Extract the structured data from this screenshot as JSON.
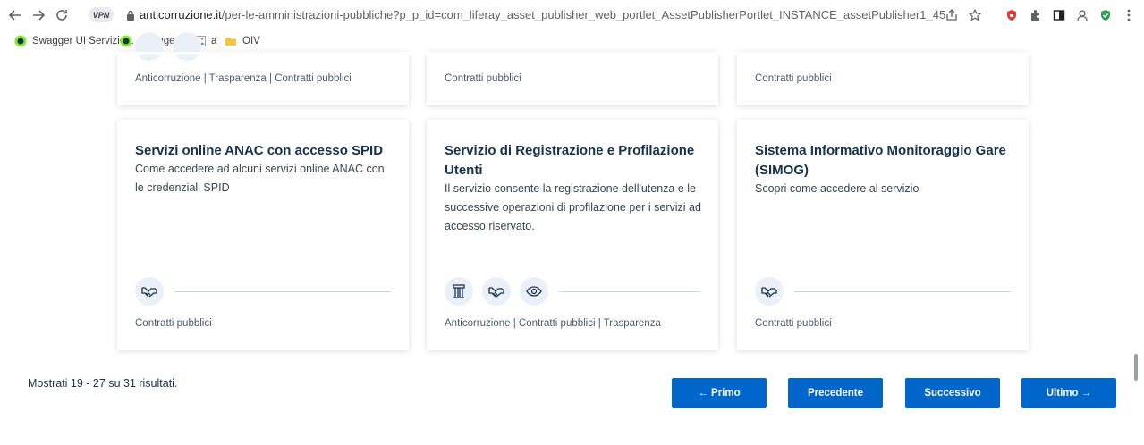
{
  "browser": {
    "vpn_label": "VPN",
    "url_host": "anticorruzione.it",
    "url_path": "/per-le-amministrazioni-pubbliche?p_p_id=com_liferay_asset_publisher_web_portlet_AssetPublisherPortlet_INSTANCE_assetPublisher1_45246&p_p_lifecycle=..."
  },
  "bookmarks": [
    {
      "label": "Swagger UI Servizio..."
    },
    {
      "label": "Swagger UI"
    },
    {
      "label": "a"
    },
    {
      "label": "OIV"
    }
  ],
  "top_row_cards": [
    {
      "categories": "Anticorruzione | Trasparenza | Contratti pubblici"
    },
    {
      "categories": "Contratti pubblici"
    },
    {
      "categories": "Contratti pubblici"
    }
  ],
  "cards": [
    {
      "title": "Servizi online ANAC con accesso SPID",
      "description": "Come accedere ad alcuni servizi online ANAC con le credenziali SPID",
      "icons": [
        "handshake-icon"
      ],
      "categories": "Contratti pubblici"
    },
    {
      "title": "Servizio di Registrazione e Profilazione Utenti",
      "description": "Il servizio consente la registrazione dell'utenza e le successive operazioni di profilazione per i servizi ad accesso riservato.",
      "icons": [
        "column-icon",
        "handshake-icon",
        "eye-icon"
      ],
      "categories": "Anticorruzione | Contratti pubblici | Trasparenza"
    },
    {
      "title": "Sistema Informativo Monitoraggio Gare (SIMOG)",
      "description": "Scopri come accedere al servizio",
      "icons": [
        "handshake-icon"
      ],
      "categories": "Contratti pubblici"
    }
  ],
  "pagination": {
    "results_text": "Mostrati 19 - 27 su 31 risultati.",
    "first": "← Primo",
    "prev": "Precedente",
    "next": "Successivo",
    "last": "Ultimo →"
  },
  "colors": {
    "primary": "#0066cc",
    "title": "#17324d",
    "icon_bg": "#e9f0f7"
  }
}
